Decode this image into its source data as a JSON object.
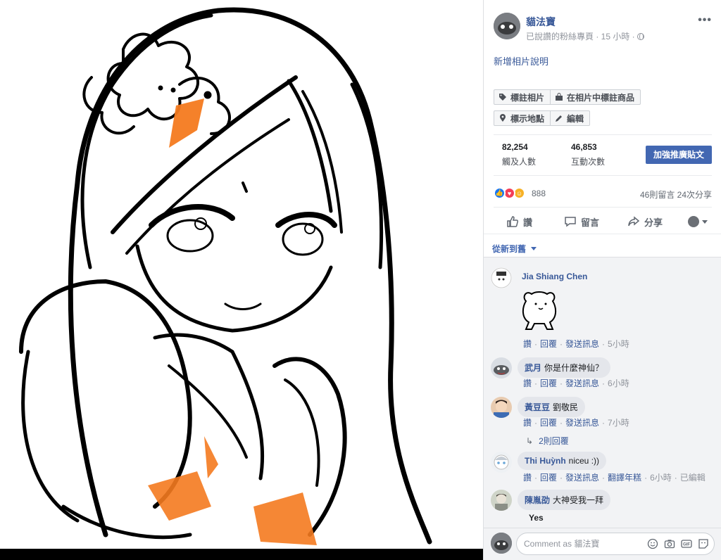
{
  "post": {
    "page_name": "貓法寶",
    "page_meta": "已說讚的粉絲專頁 · 15 小時 ·",
    "add_caption": "新增相片說明"
  },
  "tags": {
    "tag_photo": "標註相片",
    "tag_products": "在相片中標註商品",
    "add_location": "標示地點",
    "edit": "編輯"
  },
  "stats": {
    "reach_value": "82,254",
    "reach_label": "觸及人數",
    "engagement_value": "46,853",
    "engagement_label": "互動次數",
    "boost_label": "加強推廣貼文"
  },
  "reactions": {
    "count": "888",
    "comments_shares": "46則留言  24次分享"
  },
  "actions": {
    "like": "讚",
    "comment": "留言",
    "share": "分享"
  },
  "sort": {
    "label": "從新到舊"
  },
  "comments": [
    {
      "name": "Jia Shiang Chen",
      "text": "",
      "reply_actions": {
        "like": "讚",
        "reply": "回覆",
        "message": "發送訊息",
        "time": "5小時"
      }
    },
    {
      "name": "武月",
      "text": "你是什麼神仙？",
      "reply_actions": {
        "like": "讚",
        "reply": "回覆",
        "message": "發送訊息",
        "time": "6小時"
      }
    },
    {
      "name": "黃豆豆",
      "text": "劉敬民",
      "reply_actions": {
        "like": "讚",
        "reply": "回覆",
        "message": "發送訊息",
        "time": "7小時"
      },
      "replies": "2則回覆"
    },
    {
      "name": "Thi Huỳnh",
      "text": "niceu :))",
      "reply_actions": {
        "like": "讚",
        "reply": "回覆",
        "message": "發送訊息",
        "translate": "翻譯年糕",
        "time": "6小時",
        "edited": "已編輯"
      }
    },
    {
      "name": "陳胤劭",
      "text": "大神受我一拜",
      "followup": "Yes"
    }
  ],
  "composer": {
    "placeholder": "Comment as 貓法寶"
  },
  "colors": {
    "link": "#385898",
    "accent": "#4267b2",
    "bubble": "#e4e6eb",
    "orange": "#f47a1f"
  },
  "icons": [
    "tag-icon",
    "shopping-bag-icon",
    "location-pin-icon",
    "pencil-icon",
    "thumbs-up-icon",
    "comment-icon",
    "share-icon",
    "globe-icon",
    "emoji-icon",
    "camera-icon",
    "gif-icon",
    "sticker-icon"
  ]
}
